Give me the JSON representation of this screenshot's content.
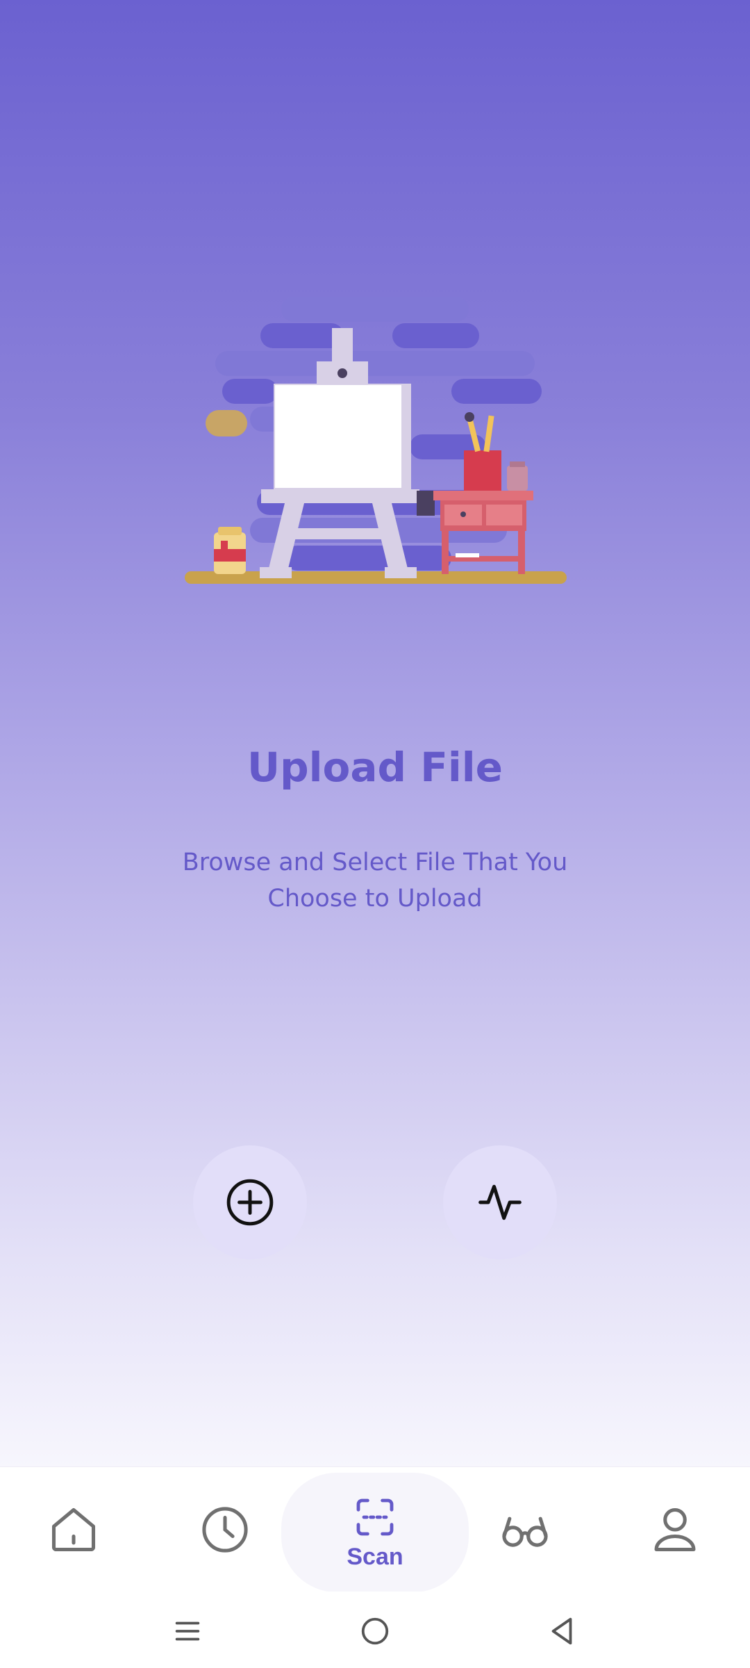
{
  "upload": {
    "title": "Upload File",
    "subtitle_line1": "Browse and Select File That You",
    "subtitle_line2": "Choose to Upload"
  },
  "actions": {
    "add_icon": "plus-circle-icon",
    "activity_icon": "activity-icon"
  },
  "bottom_nav": {
    "items": [
      {
        "icon": "home-icon",
        "label": ""
      },
      {
        "icon": "clock-icon",
        "label": ""
      },
      {
        "icon": "scan-icon",
        "label": "Scan",
        "active": true
      },
      {
        "icon": "glasses-icon",
        "label": ""
      },
      {
        "icon": "user-icon",
        "label": ""
      }
    ]
  },
  "colors": {
    "accent": "#6459c9",
    "button_bg": "#e2def9",
    "gradient_top": "#6b61d0"
  }
}
